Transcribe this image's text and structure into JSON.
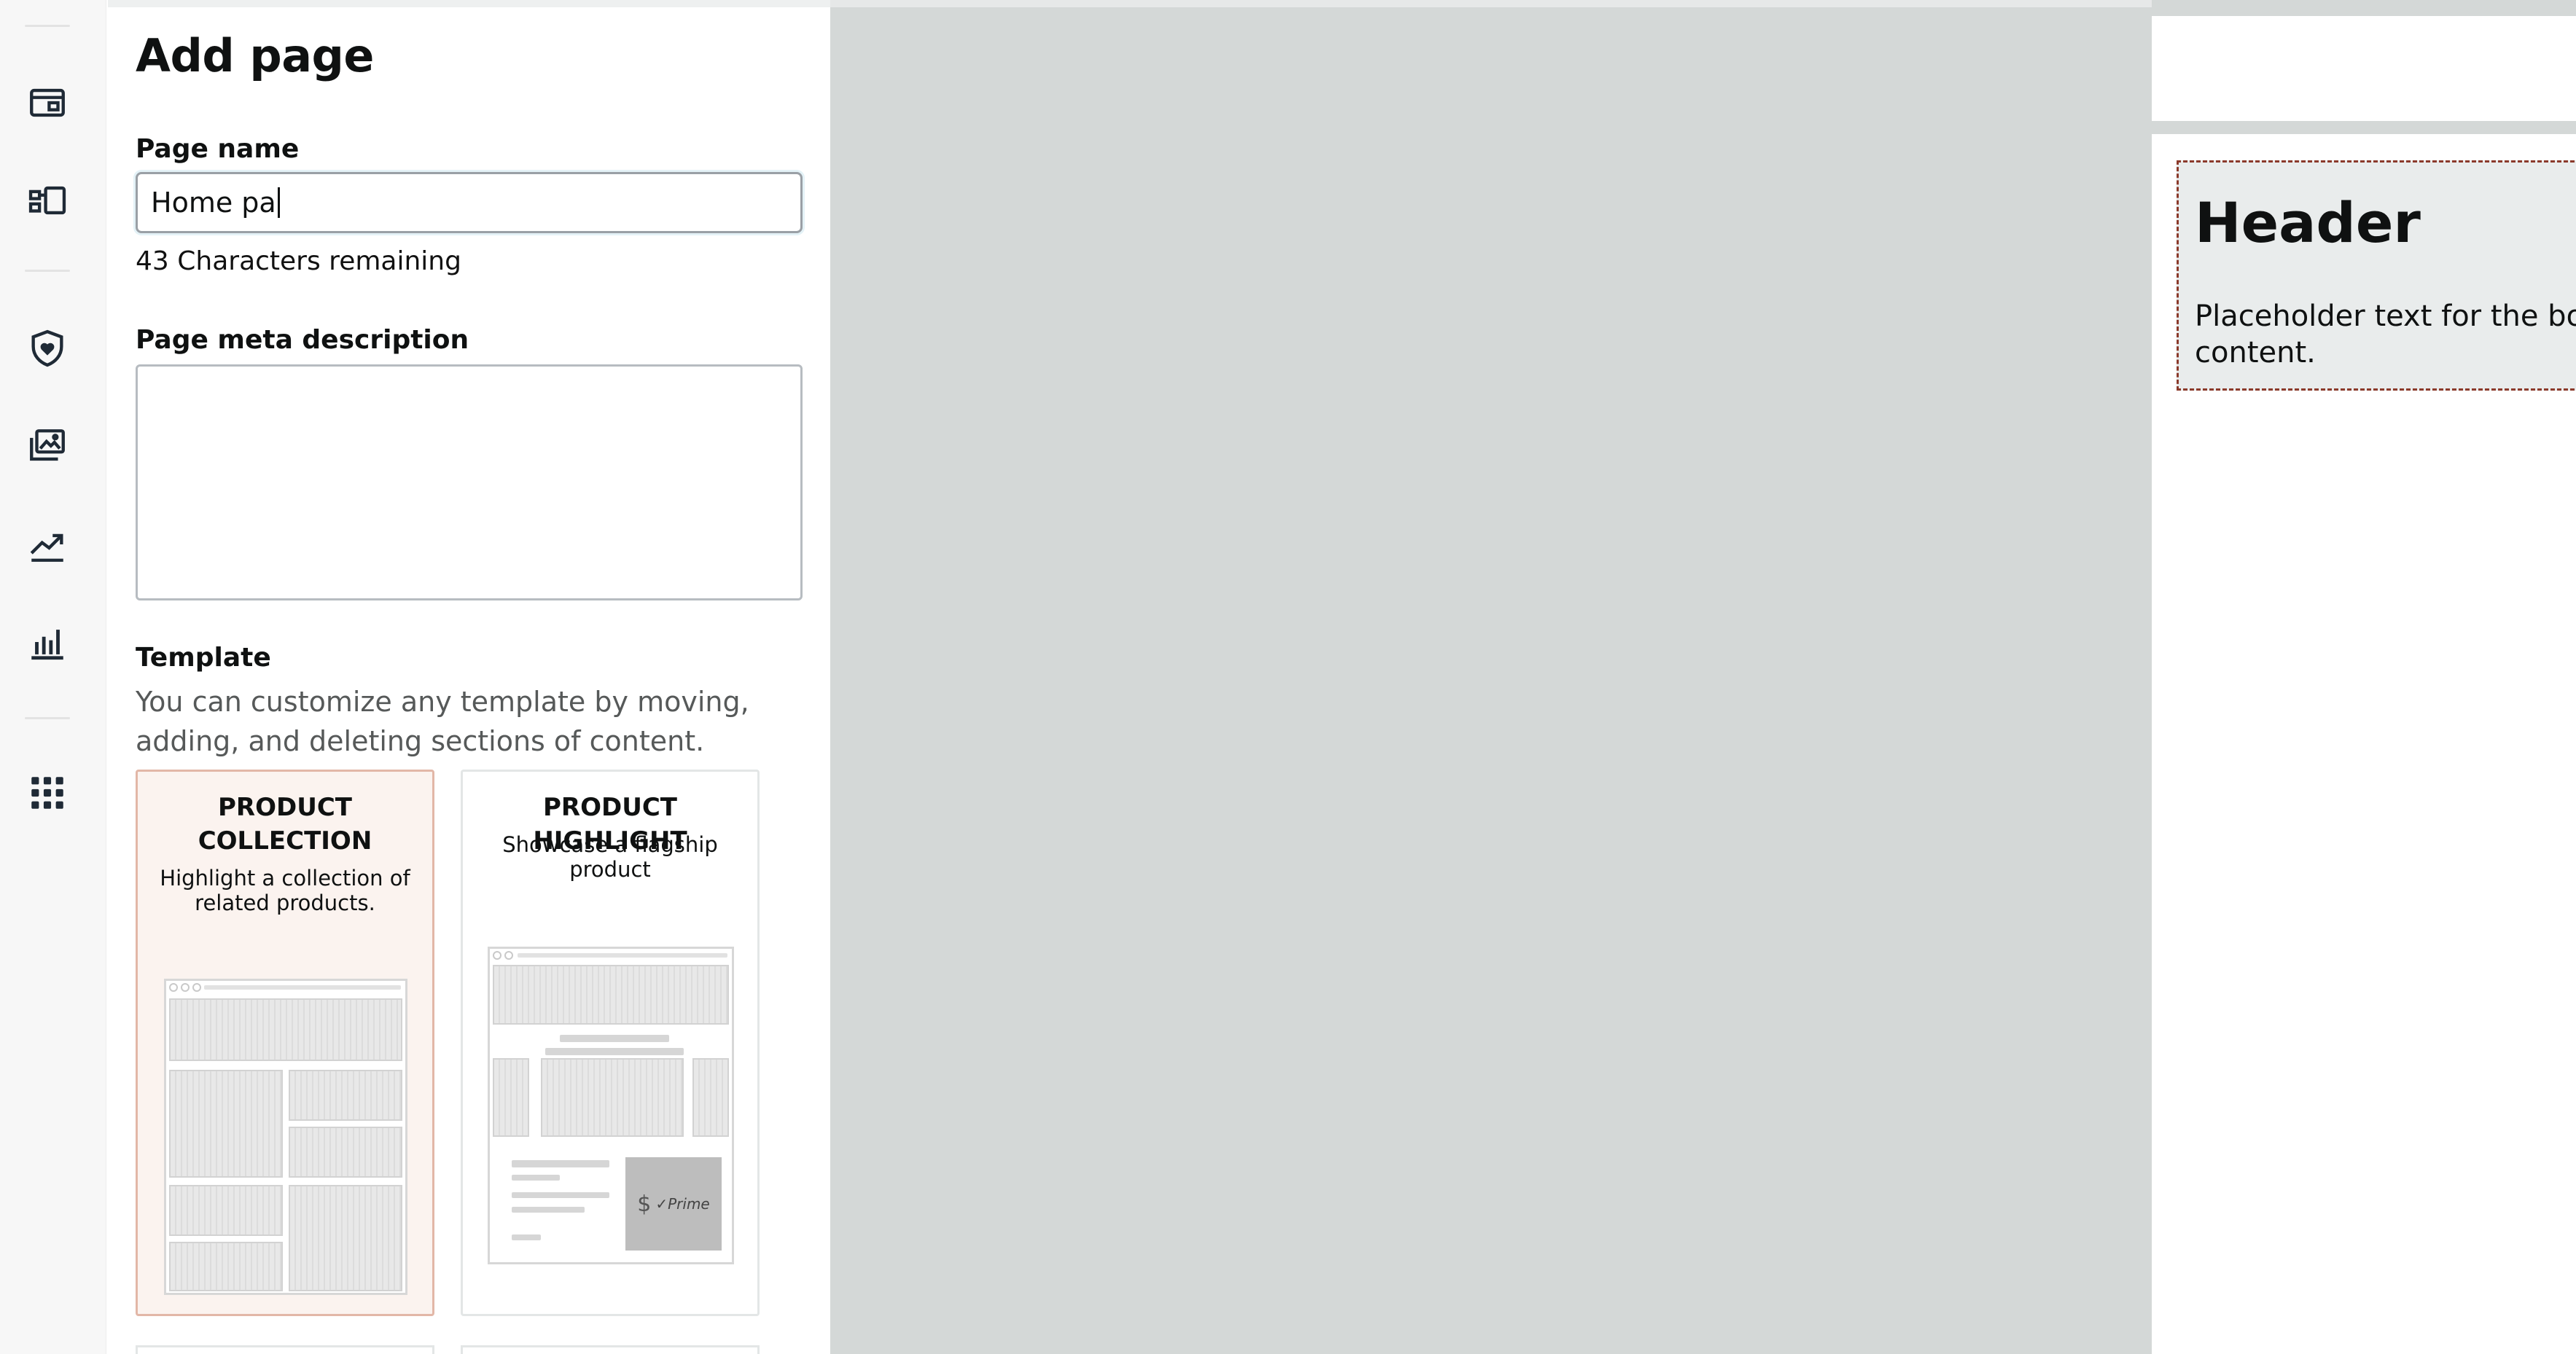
{
  "rail": {
    "icons": [
      "store-icon",
      "layout-icon",
      "shield-heart-icon",
      "image-gallery-icon",
      "trend-icon",
      "bar-chart-icon",
      "apps-grid-icon"
    ]
  },
  "panel": {
    "title": "Add page",
    "page_name_label": "Page name",
    "page_name_value": "Home pa",
    "chars_remaining": "43 Characters remaining",
    "meta_label": "Page meta description",
    "meta_value": "",
    "template_label": "Template",
    "template_desc": "You can customize any template by moving, adding, and deleting sections of content.",
    "templates": [
      {
        "title_line1": "PRODUCT",
        "title_line2": "COLLECTION",
        "desc_line1": "Highlight a collection of",
        "desc_line2": "related products.",
        "selected": true
      },
      {
        "title": "PRODUCT HIGHLIGHT",
        "desc_line1": "Showcase a flagship",
        "desc_line2": "product",
        "price_symbol": "$",
        "badge": "✓Prime",
        "selected": false
      }
    ]
  },
  "preview": {
    "header": "Header",
    "body_line1": "Placeholder text for the boc",
    "body_line2": "content."
  },
  "colors": {
    "canvas": "#d4d8d7",
    "selected_card": "#fbf3ef",
    "section_border": "#8b3a2b"
  }
}
